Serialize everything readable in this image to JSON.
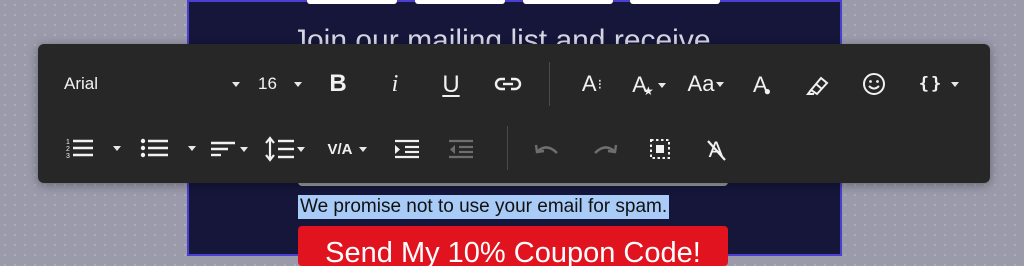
{
  "canvas": {
    "heading_partial": "Join our mailing list and receive",
    "promise_text": "We promise not to use your email for spam.",
    "cta_partial": "Send My 10% Coupon Code!"
  },
  "toolbar": {
    "font_family": "Arial",
    "font_size": "16",
    "bold_label": "B",
    "italic_label": "i",
    "underline_label": "U",
    "text_size_label": "A",
    "text_style_label": "A",
    "case_label": "Aa",
    "text_color_label": "A",
    "emoji_label": "☺",
    "merge_tags_label": "{}",
    "letter_spacing_label": "V/A",
    "clear_format_label": "A"
  },
  "colors": {
    "toolbar_bg": "#272727",
    "canvas_bg": "#15163a",
    "cta_bg": "#e1131f",
    "selection": "#a9cbf7"
  }
}
